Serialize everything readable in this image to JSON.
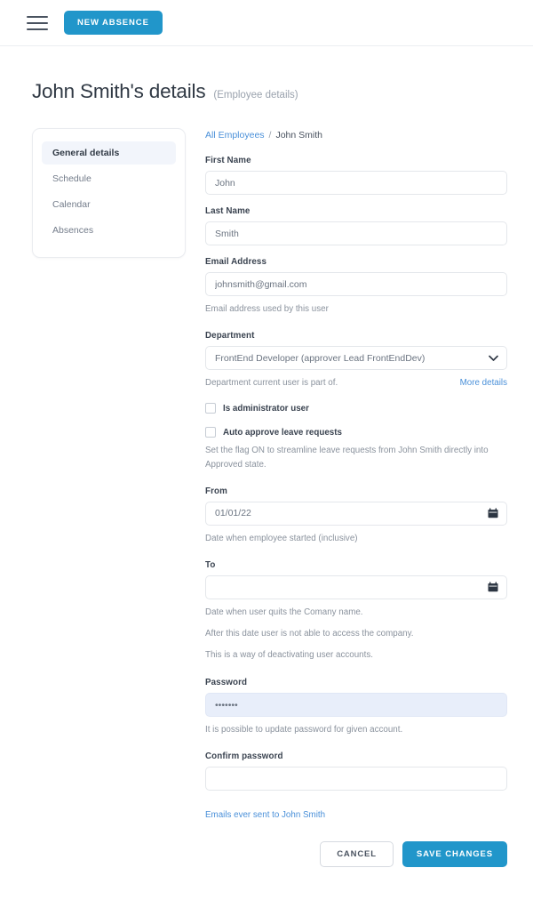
{
  "topbar": {
    "menu_icon": "hamburger-icon",
    "new_absence_label": "NEW ABSENCE"
  },
  "heading": {
    "title": "John Smith's details",
    "subtitle": "(Employee details)"
  },
  "sidebar": {
    "items": [
      {
        "label": "General details",
        "active": true
      },
      {
        "label": "Schedule",
        "active": false
      },
      {
        "label": "Calendar",
        "active": false
      },
      {
        "label": "Absences",
        "active": false
      }
    ]
  },
  "breadcrumb": {
    "root_label": "All Employees",
    "separator": "/",
    "current_label": "John Smith"
  },
  "form": {
    "first_name": {
      "label": "First Name",
      "value": "John"
    },
    "last_name": {
      "label": "Last Name",
      "value": "Smith"
    },
    "email": {
      "label": "Email Address",
      "value": "johnsmith@gmail.com",
      "helper": "Email address used by this user"
    },
    "department": {
      "label": "Department",
      "value": "FrontEnd Developer (approver Lead FrontEndDev)",
      "helper": "Department current user is part of.",
      "more_details_label": "More details",
      "chevron_icon": "chevron-down-icon"
    },
    "is_admin": {
      "label": "Is administrator user",
      "checked": false
    },
    "auto_approve": {
      "label": "Auto approve leave requests",
      "checked": false,
      "helper": "Set the flag ON to streamline leave requests from John Smith directly into Approved state."
    },
    "from": {
      "label": "From",
      "value": "01/01/22",
      "helper": "Date when employee started (inclusive)",
      "calendar_icon": "calendar-icon"
    },
    "to": {
      "label": "To",
      "value": "",
      "calendar_icon": "calendar-icon",
      "helper_1": "Date when user quits the Comany name.",
      "helper_2": "After this date user is not able to access the company.",
      "helper_3": "This is a way of deactivating user accounts."
    },
    "password": {
      "label": "Password",
      "value": "•••••••",
      "helper": "It is possible to update password for given account."
    },
    "confirm_password": {
      "label": "Confirm password",
      "value": ""
    }
  },
  "footer": {
    "emails_link_label": "Emails ever sent to John Smith",
    "cancel_label": "CANCEL",
    "save_label": "SAVE CHANGES"
  },
  "colors": {
    "accent": "#2196ca",
    "link": "#4a90d9",
    "autofill_bg": "#e8eefa",
    "active_item_bg": "#f2f5fb"
  }
}
